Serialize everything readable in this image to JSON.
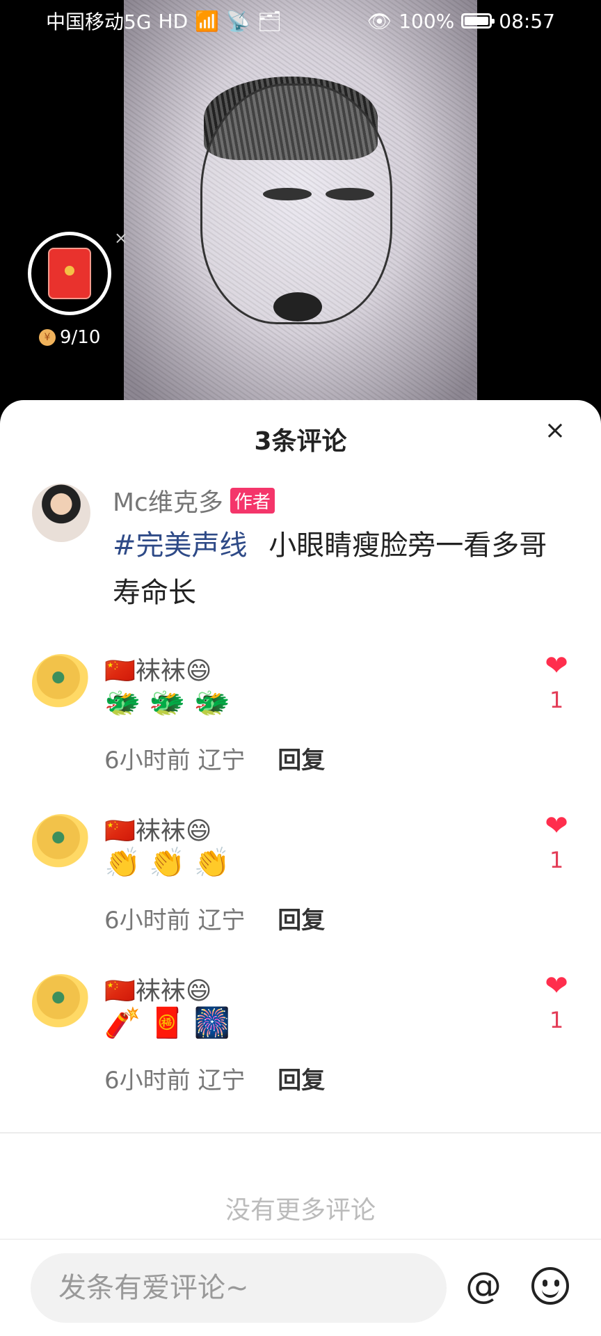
{
  "status_bar": {
    "carrier": "中国移动5G",
    "eye_percent": "100%",
    "time": "08:57"
  },
  "red_packet": {
    "count": "9/10",
    "coin_symbol": "¥"
  },
  "sheet": {
    "title": "3条评论",
    "close_symbol": "×"
  },
  "author_post": {
    "name": "Mc维克多",
    "badge": "作者",
    "hashtag": "#完美声线",
    "text": "小眼睛瘦脸旁一看多哥寿命长"
  },
  "comments": [
    {
      "name": "🇨🇳袜袜😄",
      "emoji": "🐲🐲🐲",
      "meta": "6小时前 辽宁",
      "reply": "回复",
      "likes": "1"
    },
    {
      "name": "🇨🇳袜袜😄",
      "emoji": "👏👏👏",
      "meta": "6小时前 辽宁",
      "reply": "回复",
      "likes": "1"
    },
    {
      "name": "🇨🇳袜袜😄",
      "emoji": "🧨🧧🎆",
      "meta": "6小时前 辽宁",
      "reply": "回复",
      "likes": "1"
    }
  ],
  "footer": {
    "no_more": "没有更多评论",
    "input_placeholder": "发条有爱评论~",
    "at_symbol": "@"
  },
  "side_float_symbol": "×"
}
